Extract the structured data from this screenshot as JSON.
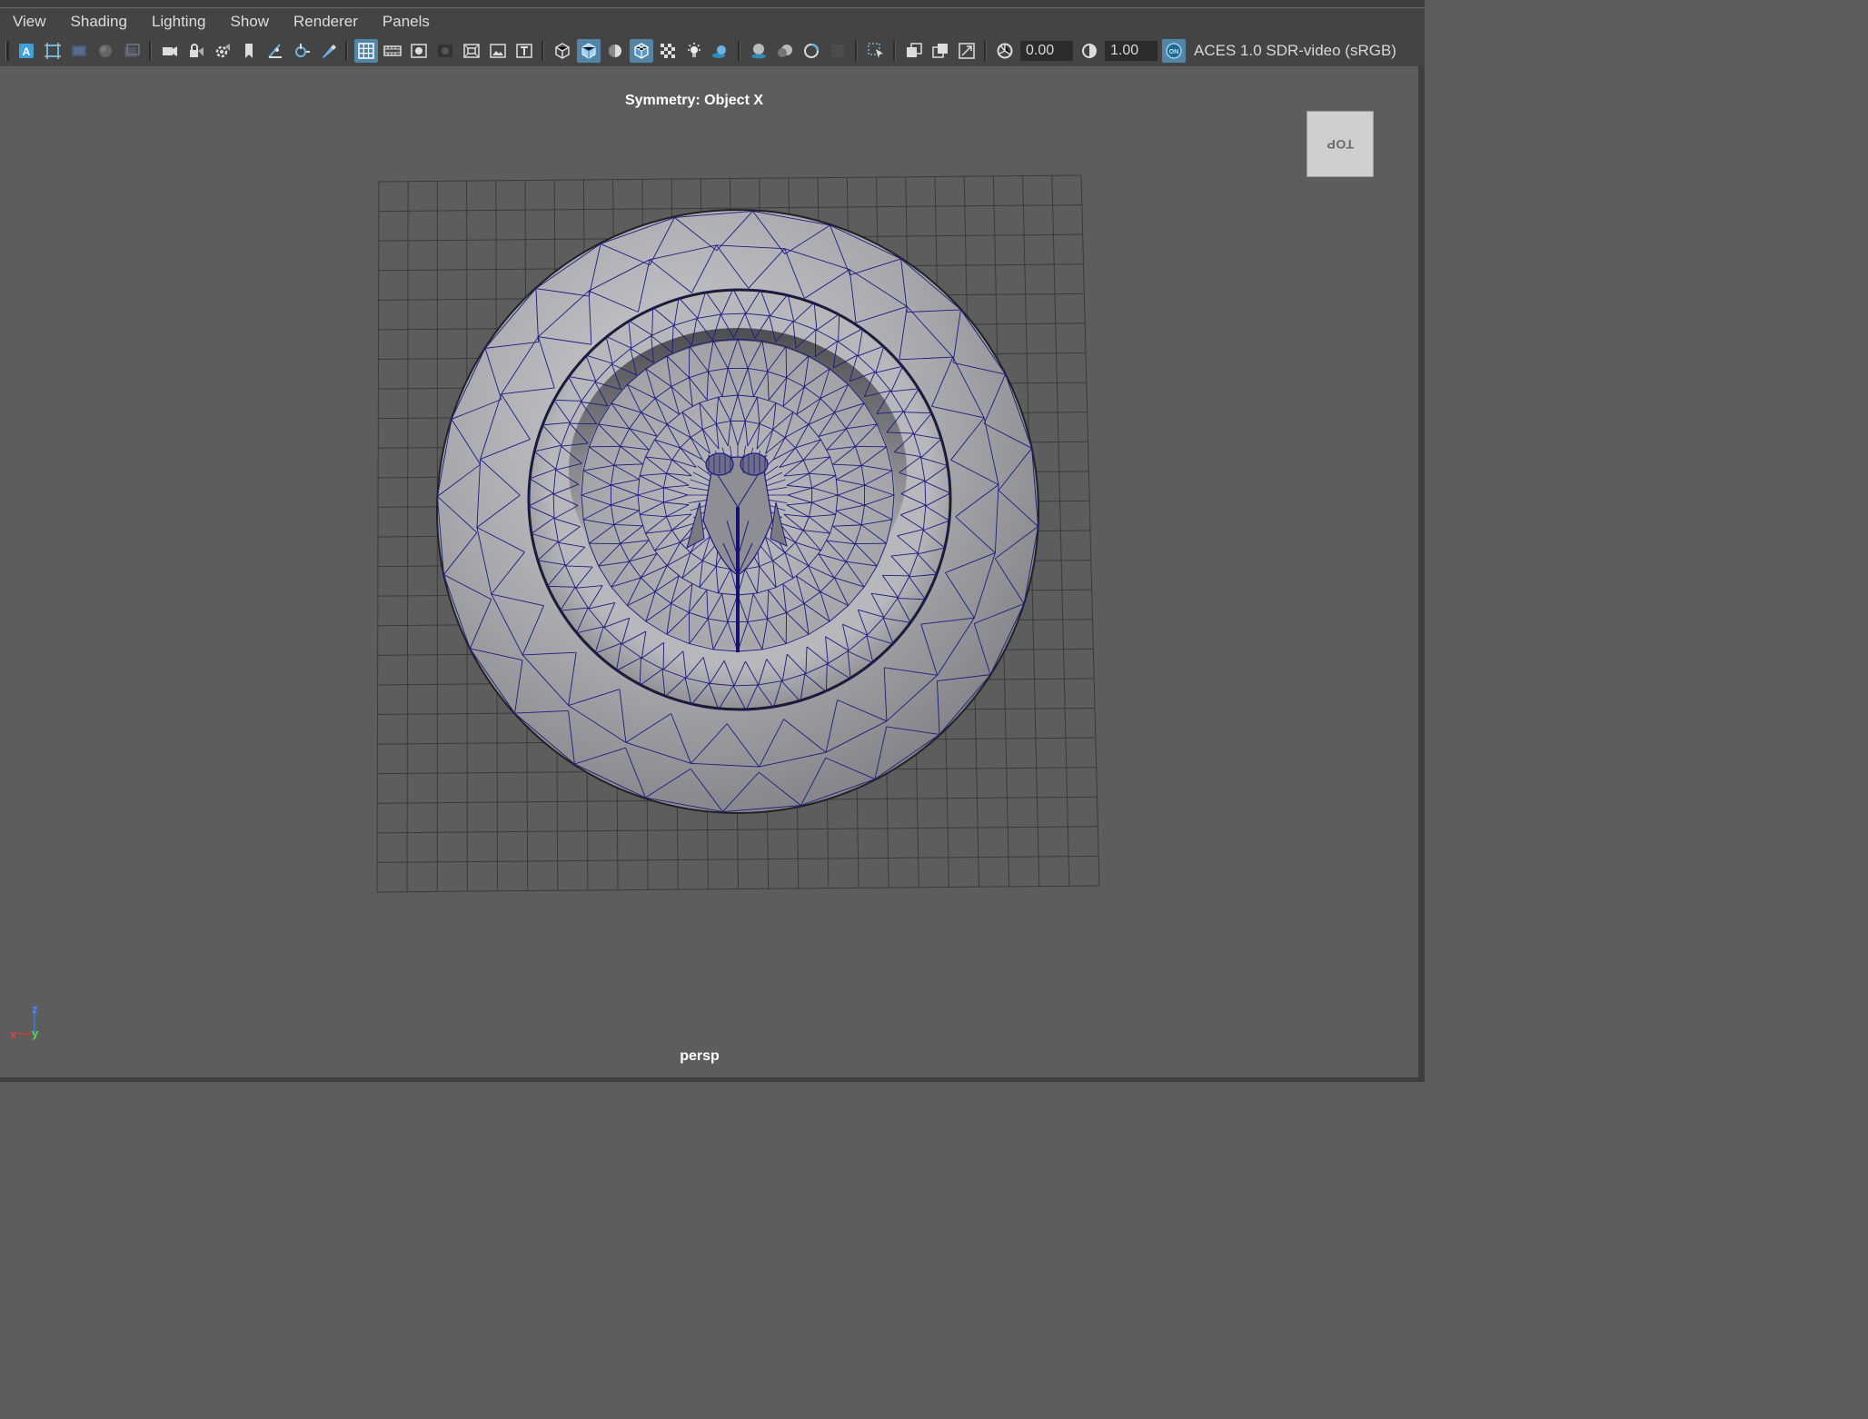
{
  "menu": {
    "items": [
      "View",
      "Shading",
      "Lighting",
      "Show",
      "Renderer",
      "Panels"
    ]
  },
  "toolbar": {
    "icons": [
      "select-camera-icon",
      "camera-attributes-icon",
      "image-plane-icon",
      "grease-pencil-icon",
      "bookmark-icon",
      "camera-icon",
      "lock-camera-icon",
      "camera-settings-icon",
      "bookmark-flag-icon",
      "snap-icon",
      "transform-icon",
      "brush-icon",
      "grid-icon",
      "film-gate-icon",
      "resolution-gate-icon",
      "gate-mask-icon",
      "field-chart-icon",
      "safe-action-icon",
      "safe-title-icon",
      "wireframe-icon",
      "smooth-shade-icon",
      "flat-shade-icon",
      "wireframe-on-shaded-icon",
      "textured-icon",
      "lights-icon",
      "shadows-icon",
      "ambient-occlusion-icon",
      "motion-blur-icon",
      "anti-aliasing-icon",
      "depth-of-field-icon",
      "isolate-select-icon",
      "xray-icon",
      "xray-active-icon",
      "xray-joints-icon",
      "exposure-icon",
      "gamma-icon",
      "color-management-icon"
    ],
    "exposure_value": "0.00",
    "gamma_value": "1.00",
    "color_space": "ACES 1.0 SDR-video (sRGB)"
  },
  "viewport": {
    "hud_title": "Symmetry: Object X",
    "viewcube_label": "TOP",
    "camera_label": "persp",
    "axis": {
      "x": "x",
      "y": "y",
      "z": "z"
    }
  },
  "colors": {
    "background": "#5d5d5d",
    "toolbar": "#444444",
    "active_button": "#5285a6",
    "wireframe": "#1a1a80",
    "grid": "#3a3a3a",
    "mesh_light": "#c8c8cc",
    "mesh_dark": "#6e6e72"
  }
}
